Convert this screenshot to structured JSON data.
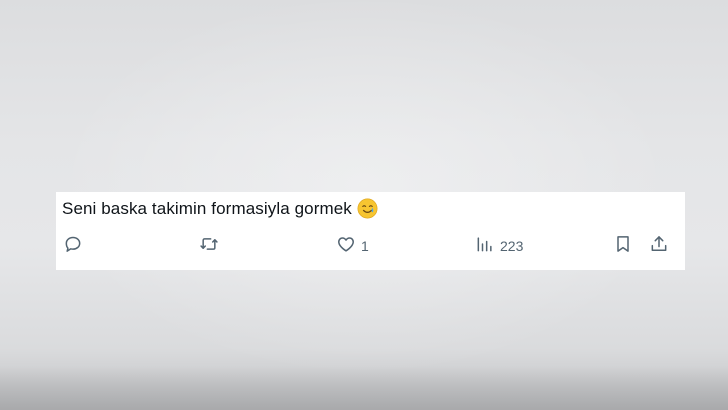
{
  "tweet": {
    "text": "Seni baska takimin formasiyla gormek",
    "emoji": "smiling-face-with-tear-icon"
  },
  "actions": {
    "reply": {
      "icon": "reply-icon",
      "count": ""
    },
    "retweet": {
      "icon": "retweet-icon",
      "count": ""
    },
    "like": {
      "icon": "heart-icon",
      "count": "1"
    },
    "views": {
      "icon": "views-chart-icon",
      "count": "223"
    },
    "bookmark": {
      "icon": "bookmark-icon"
    },
    "share": {
      "icon": "share-icon"
    }
  },
  "colors": {
    "text": "#0f1419",
    "muted": "#536471",
    "card": "#ffffff",
    "background": "#e4e5e7"
  }
}
